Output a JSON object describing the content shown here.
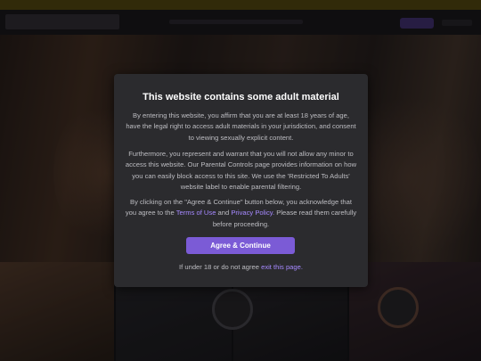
{
  "modal": {
    "title": "This website contains some adult material",
    "para1": "By entering this website, you affirm that you are at least 18 years of age, have the legal right to access adult materials in your jurisdiction, and consent to viewing sexually explicit content.",
    "para2": "Furthermore, you represent and warrant that you will not allow any minor to access this website. Our Parental Controls page provides information on how you can easily block access to this site. We use the 'Restricted To Adults' website label to enable parental filtering.",
    "para3_before": "By clicking on the \"Agree & Continue\" button below, you acknowledge that you agree to the ",
    "terms_link": "Terms of Use",
    "and": " and ",
    "privacy_link": "Privacy Policy.",
    "para3_after": " Please read them carefully before proceeding.",
    "agree_button": "Agree & Continue",
    "footer_before": "If under 18 or do not agree ",
    "exit_link": "exit this page."
  },
  "colors": {
    "accent": "#7b5bd6",
    "link": "#a689ff",
    "modal_bg": "#2b2b2e"
  }
}
